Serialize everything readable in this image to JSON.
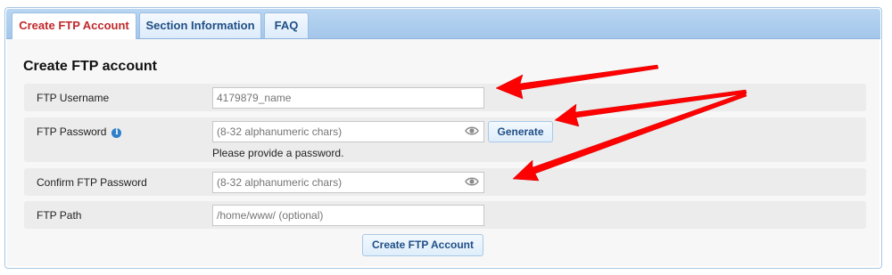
{
  "tabs": [
    {
      "label": "Create FTP Account",
      "active": true
    },
    {
      "label": "Section Information",
      "active": false
    },
    {
      "label": "FAQ",
      "active": false
    }
  ],
  "form": {
    "title": "Create FTP account",
    "username": {
      "label": "FTP Username",
      "placeholder": "4179879_name"
    },
    "password": {
      "label": "FTP Password",
      "placeholder": "(8-32 alphanumeric chars)",
      "hint": "Please provide a password.",
      "info_icon": "info-icon"
    },
    "confirm": {
      "label": "Confirm FTP Password",
      "placeholder": "(8-32 alphanumeric chars)"
    },
    "path": {
      "label": "FTP Path",
      "placeholder": "/home/www/ (optional)"
    },
    "generate_label": "Generate",
    "submit_label": "Create FTP Account"
  },
  "colors": {
    "active_tab_text": "#c0282b",
    "tab_text": "#1f4f86",
    "arrow": "#ff0000"
  }
}
